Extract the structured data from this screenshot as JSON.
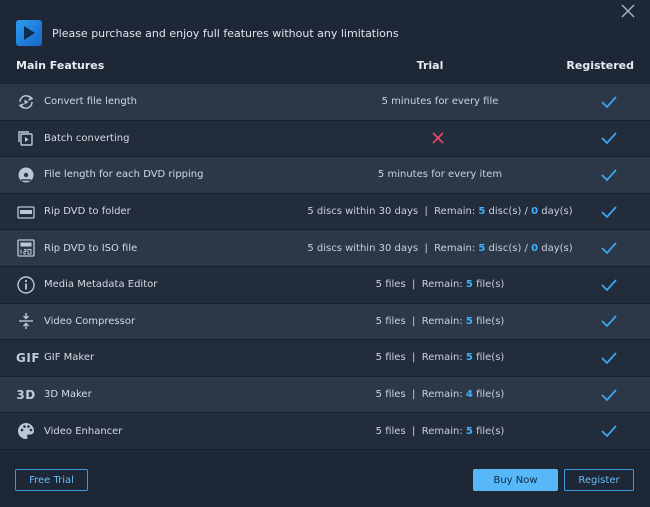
{
  "header": {
    "message": "Please purchase and enjoy full features without any limitations"
  },
  "columns": {
    "features": "Main Features",
    "trial": "Trial",
    "registered": "Registered"
  },
  "icon_labels": {
    "gif": "GIF",
    "three_d": "3D"
  },
  "rows": [
    {
      "name": "Convert file length",
      "icon": "convert-cycle-icon",
      "trial": "5 minutes for every file"
    },
    {
      "name": "Batch converting",
      "icon": "batch-icon",
      "trial_status": "not-available"
    },
    {
      "name": "File length for each DVD ripping",
      "icon": "dvd-disc-icon",
      "trial": "5 minutes for every item"
    },
    {
      "name": "Rip DVD to folder",
      "icon": "dvd-folder-icon",
      "trial_prefix": "5 discs within 30 days  |  Remain: ",
      "remain1": "5",
      "trial_mid": " disc(s) / ",
      "remain2": "0",
      "trial_suffix": " day(s)"
    },
    {
      "name": "Rip DVD to ISO file",
      "icon": "dvd-iso-icon",
      "trial_prefix": "5 discs within 30 days  |  Remain: ",
      "remain1": "5",
      "trial_mid": " disc(s) / ",
      "remain2": "0",
      "trial_suffix": " day(s)"
    },
    {
      "name": "Media Metadata Editor",
      "icon": "info-icon",
      "trial_prefix": "5 files  |  Remain: ",
      "remain1": "5",
      "trial_suffix": " file(s)"
    },
    {
      "name": "Video Compressor",
      "icon": "compress-icon",
      "trial_prefix": "5 files  |  Remain: ",
      "remain1": "5",
      "trial_suffix": " file(s)"
    },
    {
      "name": "GIF Maker",
      "icon": "gif-icon",
      "trial_prefix": "5 files  |  Remain: ",
      "remain1": "5",
      "trial_suffix": " file(s)"
    },
    {
      "name": "3D Maker",
      "icon": "3d-icon",
      "trial_prefix": "5 files  |  Remain: ",
      "remain1": "4",
      "trial_suffix": " file(s)"
    },
    {
      "name": "Video Enhancer",
      "icon": "palette-icon",
      "trial_prefix": "5 files  |  Remain: ",
      "remain1": "5",
      "trial_suffix": " file(s)"
    }
  ],
  "buttons": {
    "free_trial": "Free Trial",
    "buy_now": "Buy Now",
    "register": "Register"
  },
  "colors": {
    "accent": "#3fb0ff",
    "check": "#3aa7f5",
    "cross": "#e8496b",
    "buy_button": "#56b8f7"
  }
}
